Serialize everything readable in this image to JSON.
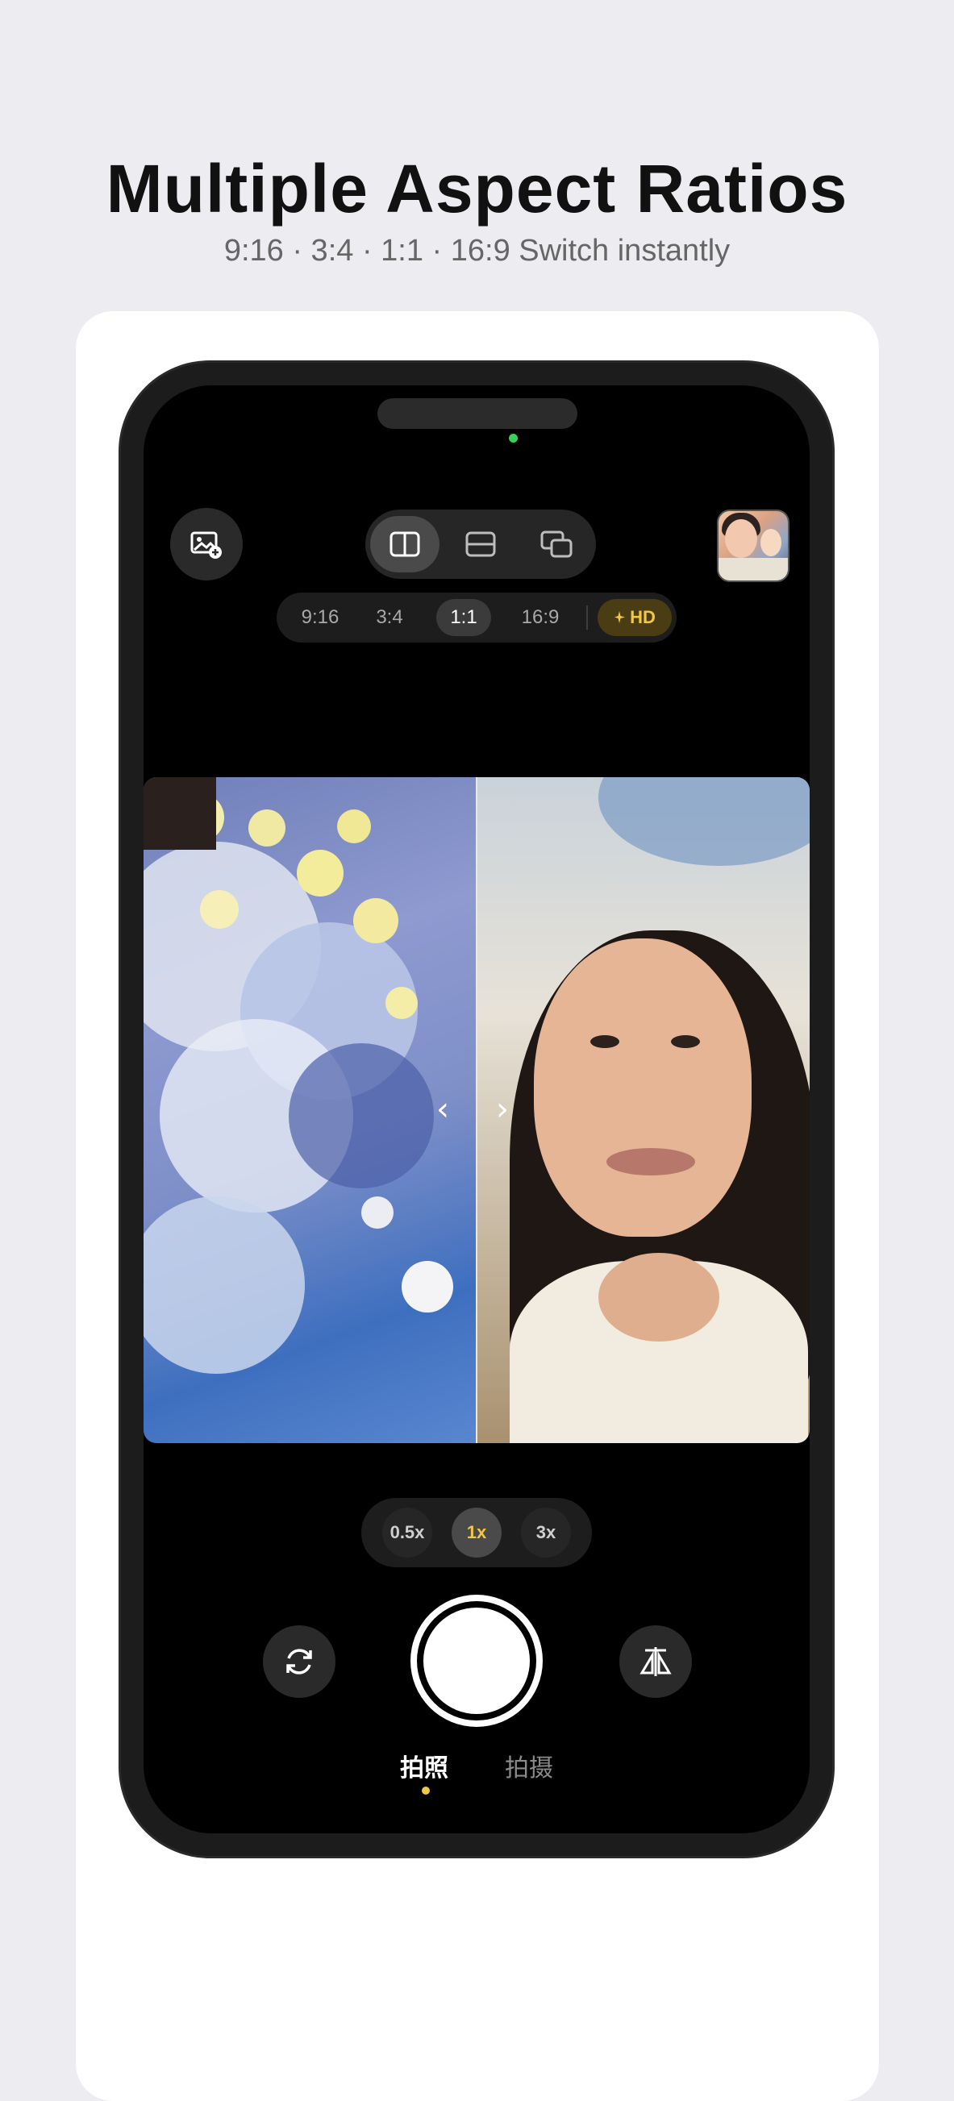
{
  "promo": {
    "title": "Multiple Aspect Ratios",
    "subtitle": "9:16 · 3:4 · 1:1 · 16:9 Switch instantly"
  },
  "camera": {
    "layout_modes": [
      {
        "name": "split-vertical",
        "icon": "split-vertical-icon",
        "active": true
      },
      {
        "name": "split-horizontal",
        "icon": "split-horizontal-icon",
        "active": false
      },
      {
        "name": "picture-in-picture",
        "icon": "pip-icon",
        "active": false
      }
    ],
    "aspect_ratios": [
      {
        "label": "9:16",
        "active": false
      },
      {
        "label": "3:4",
        "active": false
      },
      {
        "label": "1:1",
        "active": true
      },
      {
        "label": "16:9",
        "active": false
      }
    ],
    "hd_label": "HD",
    "nav_prev": "‹",
    "nav_next": "›",
    "zoom_levels": [
      {
        "label": "0.5x",
        "active": false
      },
      {
        "label": "1x",
        "active": true
      },
      {
        "label": "3x",
        "active": false
      }
    ],
    "modes": [
      {
        "label": "拍照",
        "active": true
      },
      {
        "label": "拍摄",
        "active": false
      }
    ],
    "colors": {
      "accent": "#f2c744",
      "indicator_green": "#35d35c",
      "screen_bg": "#000000",
      "page_bg": "#ececf1"
    }
  }
}
